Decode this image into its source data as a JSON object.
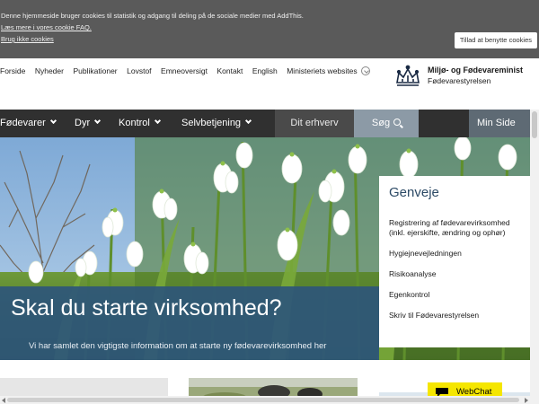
{
  "cookie": {
    "line1": "Denne hjemmeside bruger cookies til statistik og adgang til deling på de sociale medier med AddThis.",
    "line2": "Læs mere i vores cookie FAQ.",
    "line3": "Brug ikke cookies",
    "accept_label": "Tillad at benytte cookies",
    "bg_color": "#5a5a5a"
  },
  "top_links": [
    "Forside",
    "Nyheder",
    "Publikationer",
    "Lovstof",
    "Emneoversigt",
    "Kontakt",
    "English",
    "Ministeriets websites"
  ],
  "brand": {
    "name": "Miljø- og Fødevareminist",
    "sub": "Fødevarestyrelsen",
    "logo_icon": "crown-icon"
  },
  "main_nav": {
    "items": [
      "Fødevarer",
      "Dyr",
      "Kontrol",
      "Selvbetjening"
    ],
    "erhverv": "Dit erhverv",
    "search": "Søg",
    "minside": "Min Side",
    "bg_color": "#303030"
  },
  "hero": {
    "title": "Skal du starte virksomhed?",
    "subtitle": "Vi har samlet den vigtigste information om at starte ny fødevarevirksomhed her",
    "caption_color": "#2e567a"
  },
  "genveje": {
    "title": "Genveje",
    "items": [
      {
        "line1": "Registrering af fødevarevirksomhed",
        "line2": "(inkl. ejerskifte, ændring og ophør)"
      },
      {
        "line1": "Hygiejnevejledningen",
        "line2": ""
      },
      {
        "line1": "Risikoanalyse",
        "line2": ""
      },
      {
        "line1": "Egenkontrol",
        "line2": ""
      },
      {
        "line1": "Skriv til Fødevarestyrelsen",
        "line2": ""
      }
    ]
  },
  "webchat": {
    "label": "WebChat",
    "color": "#f5e600"
  }
}
